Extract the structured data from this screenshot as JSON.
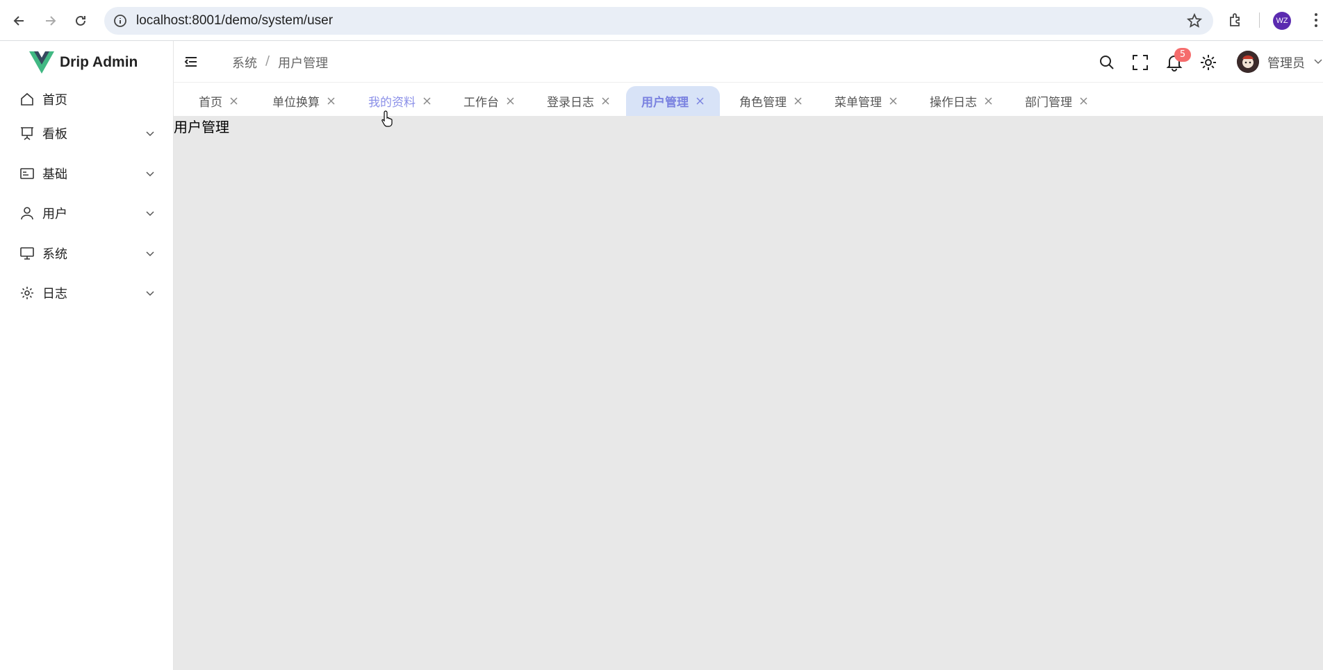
{
  "browser": {
    "url": "localhost:8001/demo/system/user",
    "profile_initials": "WZ"
  },
  "sidebar": {
    "app_name": "Drip Admin",
    "items": [
      {
        "label": "首页",
        "icon": "home-icon",
        "expandable": false
      },
      {
        "label": "看板",
        "icon": "presentation-board-icon",
        "expandable": true
      },
      {
        "label": "基础",
        "icon": "id-card-icon",
        "expandable": true
      },
      {
        "label": "用户",
        "icon": "user-icon",
        "expandable": true
      },
      {
        "label": "系统",
        "icon": "monitor-icon",
        "expandable": true
      },
      {
        "label": "日志",
        "icon": "gear-icon",
        "expandable": true
      }
    ]
  },
  "header": {
    "breadcrumb": [
      "系统",
      "用户管理"
    ],
    "breadcrumb_separator": "/",
    "notification_count": "5",
    "username": "管理员"
  },
  "tabs": [
    {
      "label": "首页",
      "state": "normal"
    },
    {
      "label": "单位换算",
      "state": "normal"
    },
    {
      "label": "我的资料",
      "state": "hover"
    },
    {
      "label": "工作台",
      "state": "normal"
    },
    {
      "label": "登录日志",
      "state": "normal"
    },
    {
      "label": "用户管理",
      "state": "active"
    },
    {
      "label": "角色管理",
      "state": "normal"
    },
    {
      "label": "菜单管理",
      "state": "normal"
    },
    {
      "label": "操作日志",
      "state": "normal"
    },
    {
      "label": "部门管理",
      "state": "normal"
    }
  ],
  "content": {
    "text": "用户管理"
  },
  "colors": {
    "accent": "#7a82e0",
    "active_tab_bg": "#d8e3f7",
    "badge": "#f56c6c",
    "logo_green": "#41b883",
    "logo_dark": "#35495e",
    "content_bg": "#e8e8e8"
  }
}
